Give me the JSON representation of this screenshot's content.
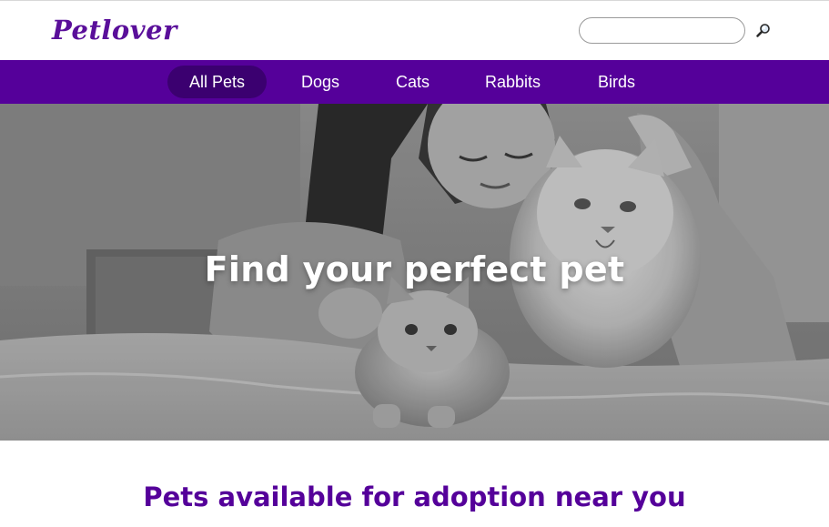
{
  "brand": {
    "logo": "Petlover",
    "accent_color": "#5a0f9a",
    "nav_color": "#55009a",
    "nav_active_color": "#3b0070"
  },
  "search": {
    "placeholder": "",
    "value": "",
    "icon": "magnifier-icon"
  },
  "nav": {
    "items": [
      {
        "label": "All Pets",
        "active": true
      },
      {
        "label": "Dogs",
        "active": false
      },
      {
        "label": "Cats",
        "active": false
      },
      {
        "label": "Rabbits",
        "active": false
      },
      {
        "label": "Birds",
        "active": false
      }
    ]
  },
  "hero": {
    "title": "Find your perfect pet",
    "image": "grayscale photo of a woman lying on a bed with two cats"
  },
  "main": {
    "section_title": "Pets available for adoption near you"
  }
}
